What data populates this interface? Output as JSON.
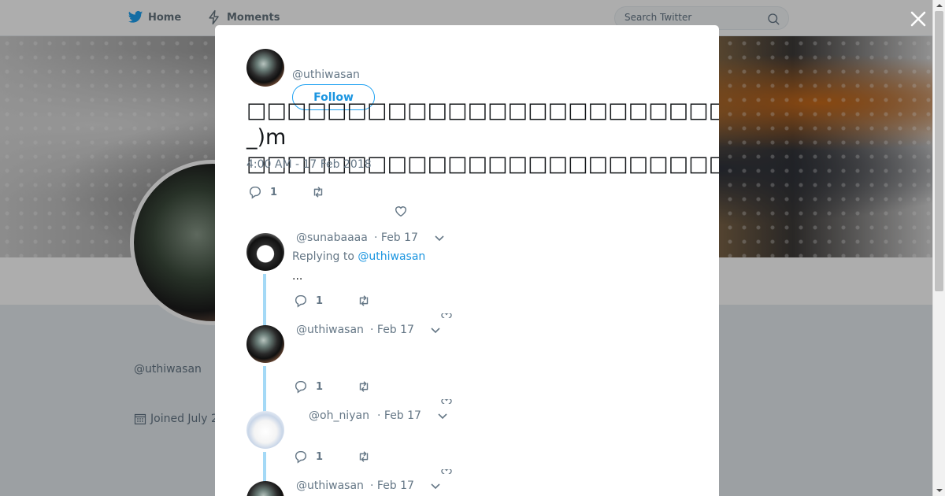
{
  "nav": {
    "home_label": "Home",
    "moments_label": "Moments",
    "search_placeholder": "Search Twitter"
  },
  "profile": {
    "handle": "@uthiwasan",
    "joined": "Joined July 2"
  },
  "tweet": {
    "handle": "@uthiwasan",
    "follow_label": "Follow",
    "text_line1": "□□□□□□□□□□□□□□□□□□□□□□□□□m(_ _)m",
    "text_line2": "□□□□□□□□□□□□□□□□□□□□□□□□□…",
    "timestamp": "4:00 AM - 17 Feb 2018",
    "reply_count": "1"
  },
  "replies": [
    {
      "handle": "@sunabaaaa",
      "date": "· Feb 17",
      "replying_prefix": "Replying to",
      "replying_to": "@uthiwasan",
      "text": "...",
      "reply_count": "1"
    },
    {
      "handle": "@uthiwasan",
      "date": "· Feb 17",
      "text": "",
      "reply_count": "1"
    },
    {
      "handle": "@oh_niyan",
      "date": "· Feb 17",
      "text": "",
      "reply_count": "1"
    },
    {
      "handle": "@uthiwasan",
      "date": "· Feb 17"
    }
  ],
  "icons": {
    "twitter_bird": "twitter-bird-icon",
    "moments": "lightning-icon",
    "search": "search-icon",
    "close": "close-icon",
    "reply": "reply-icon",
    "retweet": "retweet-icon",
    "like": "heart-icon",
    "caret": "chevron-down-icon",
    "calendar": "calendar-icon"
  },
  "colors": {
    "accent": "#1da1f2",
    "link": "#1b95e0",
    "muted": "#657786",
    "thread_line": "#a4d9f6"
  }
}
